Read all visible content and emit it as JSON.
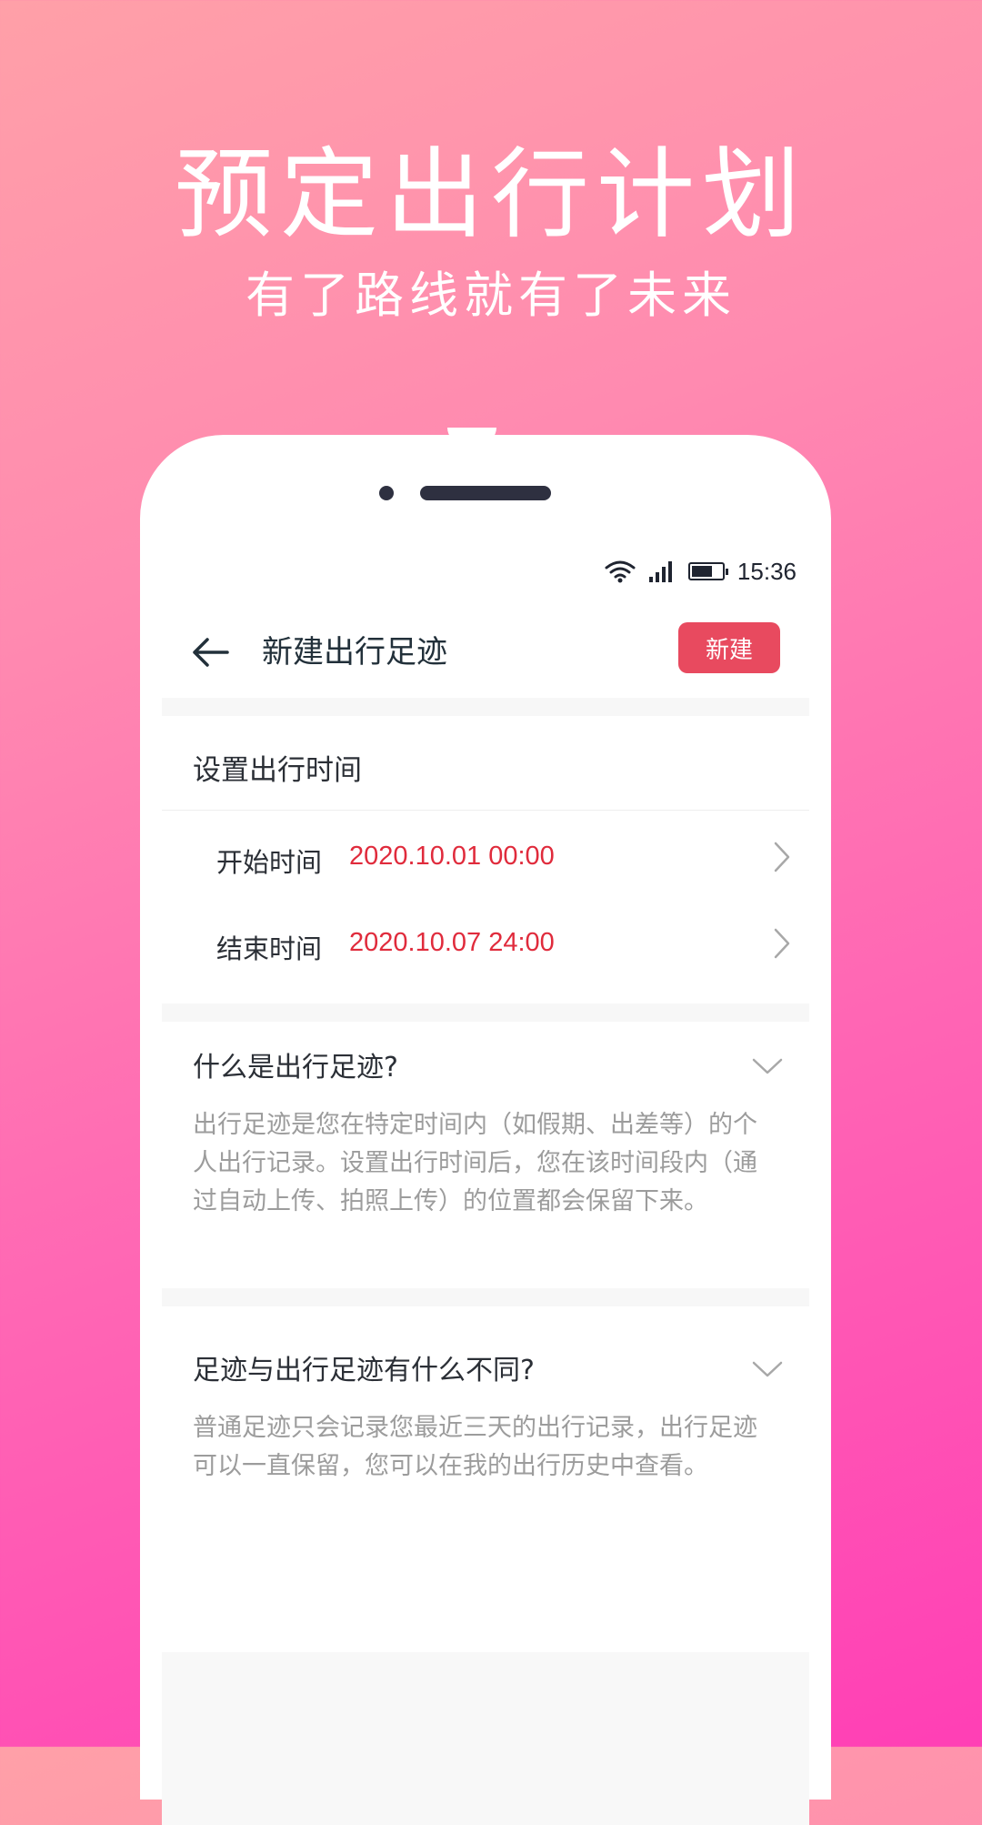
{
  "promo": {
    "headline": "预定出行计划",
    "subline": "有了路线就有了未来"
  },
  "status_bar": {
    "time": "15:36",
    "icons": [
      "wifi-icon",
      "signal-icon",
      "battery-icon"
    ]
  },
  "app_bar": {
    "back_icon": "arrow-left-icon",
    "title": "新建出行足迹",
    "create_label": "新建",
    "create_color": "#e84a5f"
  },
  "time_section": {
    "title": "设置出行时间",
    "rows": [
      {
        "label": "开始时间",
        "value": "2020.10.01 00:00"
      },
      {
        "label": "结束时间",
        "value": "2020.10.07 24:00"
      }
    ],
    "value_color": "#e02b3c"
  },
  "faq": [
    {
      "question": "什么是出行足迹?",
      "answer": "出行足迹是您在特定时间内（如假期、出差等）的个人出行记录。设置出行时间后，您在该时间段内（通过自动上传、拍照上传）的位置都会保留下来。"
    },
    {
      "question": "足迹与出行足迹有什么不同?",
      "answer": "普通足迹只会记录您最近三天的出行记录，出行足迹可以一直保留，您可以在我的出行历史中查看。"
    }
  ]
}
